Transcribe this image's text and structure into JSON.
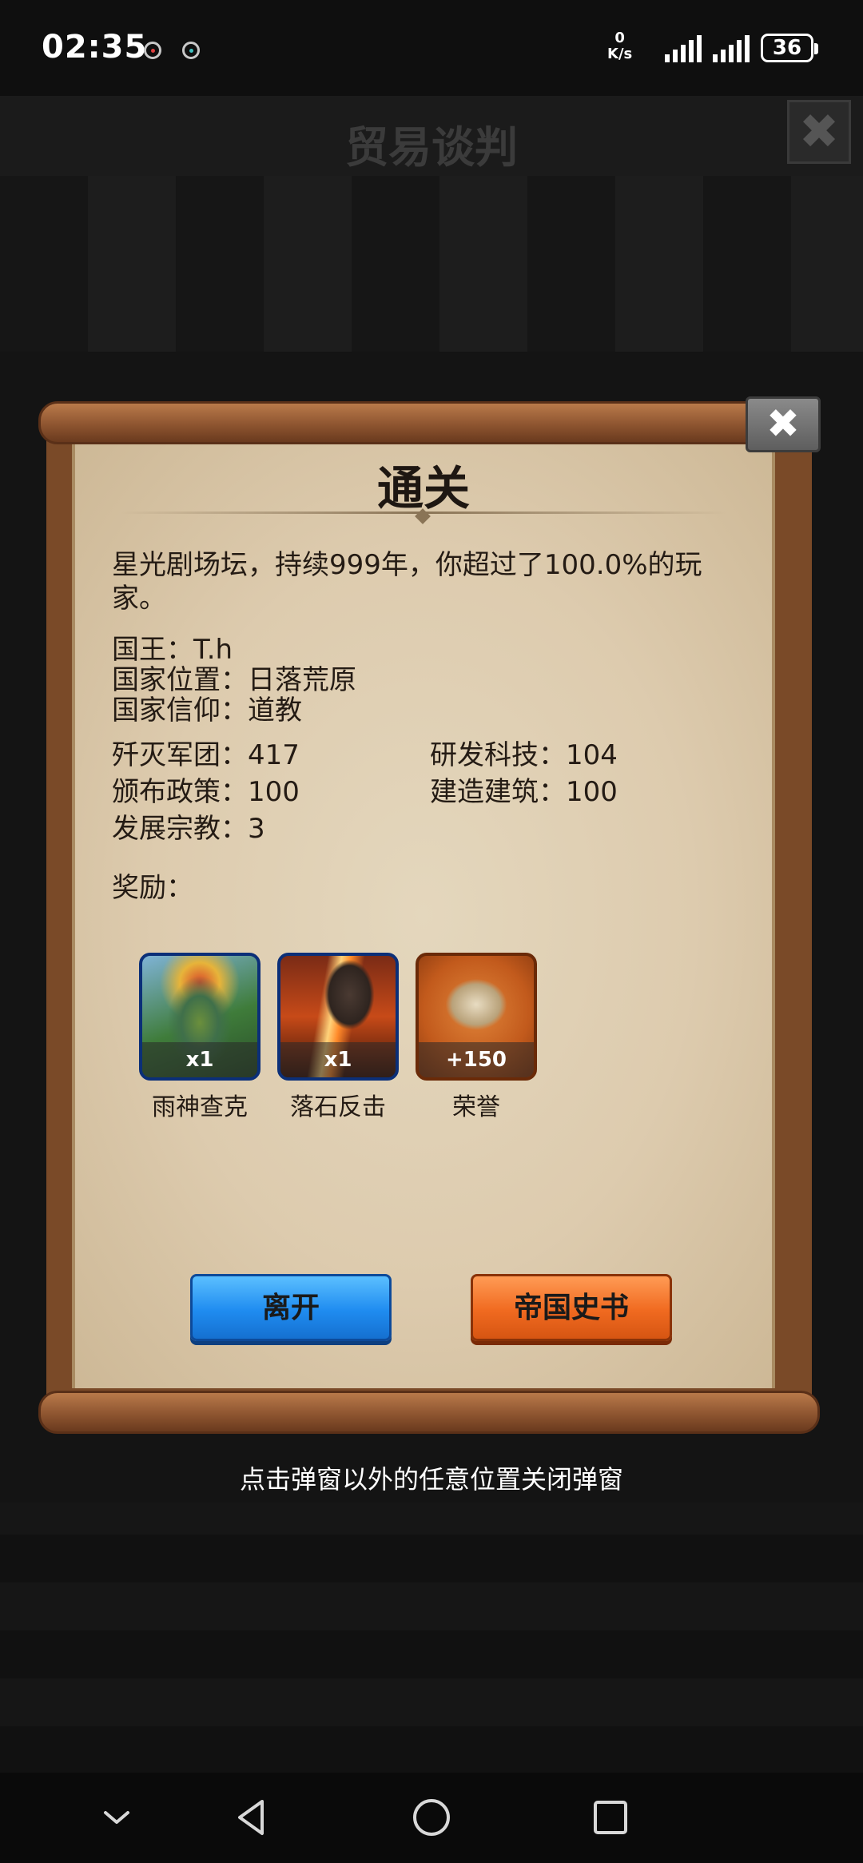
{
  "status_bar": {
    "time": "02:35",
    "net_speed_value": "0",
    "net_speed_unit": "K/s",
    "battery": "36"
  },
  "background": {
    "title": "贸易谈判"
  },
  "dialog": {
    "title": "通关",
    "summary": "星光剧场坛，持续999年，你超过了100.0%的玩家。",
    "info": [
      {
        "label": "国王：",
        "value": "T.h"
      },
      {
        "label": "国家位置：",
        "value": "日落荒原"
      },
      {
        "label": "国家信仰：",
        "value": "道教"
      }
    ],
    "stats_left": [
      {
        "label": "歼灭军团：",
        "value": "417"
      },
      {
        "label": "颁布政策：",
        "value": "100"
      },
      {
        "label": "发展宗教：",
        "value": "3"
      }
    ],
    "stats_right": [
      {
        "label": "研发科技：",
        "value": "104"
      },
      {
        "label": "建造建筑：",
        "value": "100"
      }
    ],
    "rewards_label": "奖励：",
    "rewards": [
      {
        "name": "雨神查克",
        "count": "x1",
        "icon": "rain-god-portrait"
      },
      {
        "name": "落石反击",
        "count": "x1",
        "icon": "falling-rock"
      },
      {
        "name": "荣誉",
        "count": "+150",
        "icon": "honor-crest"
      }
    ],
    "leave_button": "离开",
    "history_button": "帝国史书",
    "close_icon": "✖"
  },
  "hint": "点击弹窗以外的任意位置关闭弹窗",
  "colors": {
    "blue_button": "#1f8cf0",
    "orange_button": "#f06a20",
    "parchment": "#ddcbae"
  }
}
